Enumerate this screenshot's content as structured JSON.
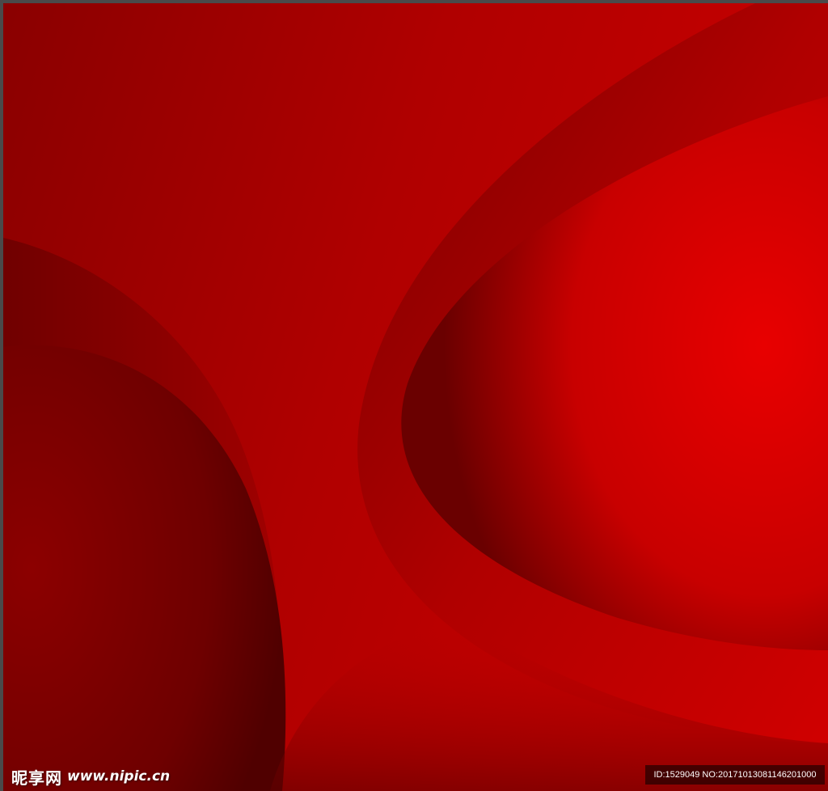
{
  "watermark": {
    "site_name": "昵享网",
    "url": "www.nipic.cn"
  },
  "info": {
    "id_label": "ID:1529049 NO:20171013081146201000"
  },
  "colors": {
    "background": "#b80000",
    "dark": "#5e0000",
    "bright": "#e60000",
    "frame": "#4a4a4a"
  }
}
